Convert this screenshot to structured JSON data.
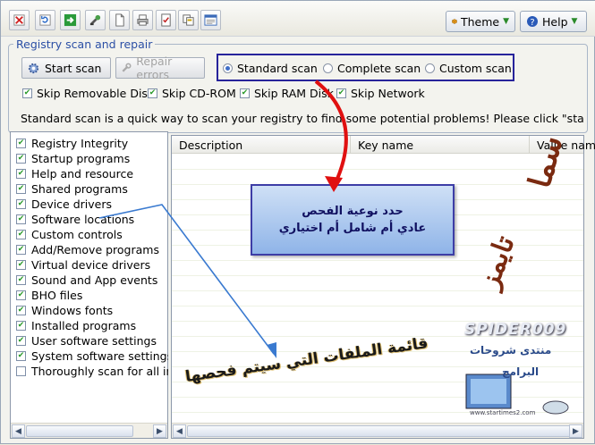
{
  "toolbar": {
    "icons": [
      "clear-icon",
      "refresh-icon",
      "export-icon",
      "repair-tool-icon",
      "document-icon",
      "printer-icon",
      "properties-icon",
      "copy-icon",
      "window-icon"
    ],
    "theme_label": "Theme",
    "help_label": "Help"
  },
  "scan": {
    "group_title": "Registry scan and repair",
    "start_label": "Start scan",
    "repair_label": "Repair errors",
    "modes": [
      "Standard scan",
      "Complete scan",
      "Custom scan"
    ],
    "selected_mode": "Standard scan",
    "skip": [
      {
        "label": "Skip Removable Disk",
        "checked": true
      },
      {
        "label": "Skip CD-ROM",
        "checked": true
      },
      {
        "label": "Skip RAM Disk",
        "checked": true
      },
      {
        "label": "Skip Network",
        "checked": true
      }
    ],
    "info": "Standard scan is a quick way to scan your registry to find some potential problems! Please click \"start scan\" b..."
  },
  "categories": [
    {
      "label": "Registry Integrity",
      "checked": true
    },
    {
      "label": "Startup programs",
      "checked": true
    },
    {
      "label": "Help and resource",
      "checked": true
    },
    {
      "label": "Shared programs",
      "checked": true
    },
    {
      "label": "Device drivers",
      "checked": true
    },
    {
      "label": "Software locations",
      "checked": true
    },
    {
      "label": "Custom controls",
      "checked": true
    },
    {
      "label": "Add/Remove programs",
      "checked": true
    },
    {
      "label": "Virtual device drivers",
      "checked": true
    },
    {
      "label": "Sound and App events",
      "checked": true
    },
    {
      "label": "BHO files",
      "checked": true
    },
    {
      "label": "Windows fonts",
      "checked": true
    },
    {
      "label": "Installed programs",
      "checked": true
    },
    {
      "label": "User software settings",
      "checked": true
    },
    {
      "label": "System software settings",
      "checked": true
    },
    {
      "label": "Thoroughly scan for all invalid",
      "checked": false
    }
  ],
  "results": {
    "columns": [
      "Description",
      "Key name",
      "Value name"
    ]
  },
  "annotations": {
    "callout_line1": "حدد نوعية الفحص",
    "callout_line2": "عادي أم شامل أم اختياري",
    "list_note": "قائمة الملفات التي سيتم فحصها",
    "signature_line1": "سما",
    "signature_line2": "تايمز",
    "logo_name": "SPIDER009",
    "logo_forum": "منتدى شروحات",
    "logo_programs": "البرامج",
    "logo_url": "www.startimes2.com"
  },
  "colors": {
    "accent_blue": "#27239b",
    "arrow_red": "#e01010",
    "check_green": "#2a9a2a"
  }
}
